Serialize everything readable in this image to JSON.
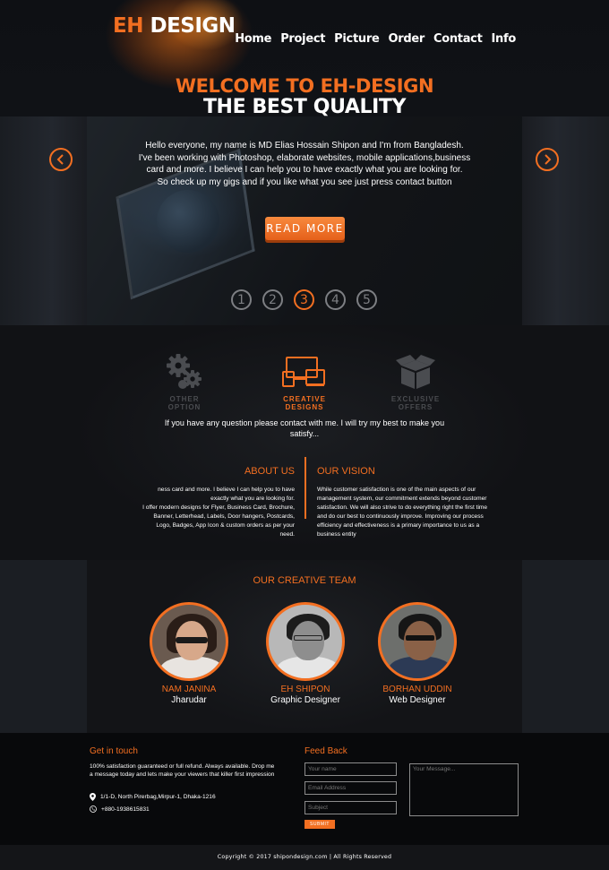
{
  "brand": {
    "eh": "EH",
    "design": "DESIGN"
  },
  "nav": [
    {
      "label": "Home"
    },
    {
      "label": "Project"
    },
    {
      "label": "Picture"
    },
    {
      "label": "Order"
    },
    {
      "label": "Contact"
    },
    {
      "label": "Info"
    }
  ],
  "hero": {
    "title_line1": "WELCOME TO EH-DESIGN",
    "title_line2": "THE BEST QUALITY",
    "intro_lines": [
      "Hello everyone, my name is MD Elias Hossain Shipon and I'm from Bangladesh.",
      "I've been working with Photoshop, elaborate websites, mobile applications,business",
      "card and more. I believe I can help you to have exactly what you are looking for.",
      "So check up my gigs and if you like what you see just press contact button"
    ],
    "read_more_label": "READ MORE",
    "slides": [
      "1",
      "2",
      "3",
      "4",
      "5"
    ],
    "active_slide": "3"
  },
  "features": {
    "items": [
      {
        "label_line1": "OTHER",
        "label_line2": "OPTION",
        "icon": "gears-icon"
      },
      {
        "label_line1": "CREATIVE",
        "label_line2": "DESIGNS",
        "icon": "devices-icon"
      },
      {
        "label_line1": "EXCLUSIVE",
        "label_line2": "OFFERS",
        "icon": "box-icon"
      }
    ],
    "text": "If you have any question please contact with me. I will try my best to make you satisfy..."
  },
  "about": {
    "title": "ABOUT US",
    "lines": [
      "ness card and more. I believe I can help you to have",
      "exactly what you are looking for.",
      "I offer modern designs for Flyer, Business Card, Brochure,",
      "Banner, Letterhead, Labels, Door hangers, Postcards,",
      "Logo, Badges, App Icon & custom orders as per your",
      "need."
    ]
  },
  "vision": {
    "title": "OUR VISION",
    "lines": [
      "While customer satisfaction is one of the main aspects of our",
      "management system, our commitment extends beyond customer",
      "satisfaction. We will also strive to do everything right the first time",
      "and do our best to continuously improve. Improving our process",
      "efficiency and effectiveness is a primary importance to us as a",
      "business entity"
    ]
  },
  "team": {
    "title": "OUR CREATIVE TEAM",
    "members": [
      {
        "name": "NAM JANINA",
        "role": "Jharudar"
      },
      {
        "name": "EH SHIPON",
        "role": "Graphic Designer"
      },
      {
        "name": "BORHAN UDDIN",
        "role": "Web Designer"
      }
    ]
  },
  "footer": {
    "get_in_touch_title": "Get in touch",
    "get_in_touch_lines": [
      "100% satisfaction guaranteed or full refund. Always available. Drop me",
      "a message today and lets make your viewers that killer first impression"
    ],
    "address": "1/1-D, North Pirerbag,Mirpur-1, Dhaka-1216",
    "phone": "+880-1938615831",
    "feedback_title": "Feed Back",
    "name_placeholder": "Your name",
    "email_placeholder": "Email Address",
    "subject_placeholder": "Subject",
    "message_placeholder": "Your Message...",
    "submit_label": "SUBMIT",
    "copyright": "Copyright © 2017 shipondesign.com   |   All Rights Reserved"
  },
  "colors": {
    "accent": "#f36f21",
    "background": "#0a0b0d"
  }
}
